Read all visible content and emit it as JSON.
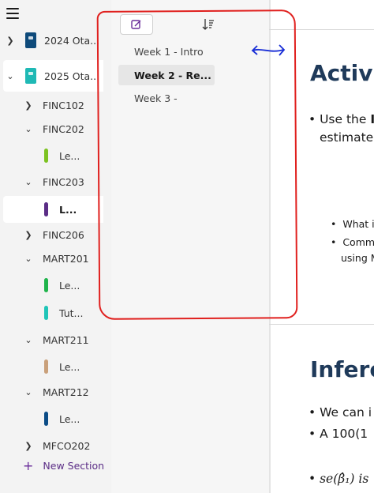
{
  "sidebar": {
    "notebooks": [
      {
        "label": "2024 Ota...",
        "color": "#0e4a7a",
        "expanded": false
      },
      {
        "label": "2025 Ota...",
        "color": "#1fb9b5",
        "expanded": true
      }
    ],
    "sections": [
      {
        "label": "FINC102",
        "expanded": false
      },
      {
        "label": "FINC202",
        "expanded": true,
        "pages": [
          {
            "label": "Le...",
            "color": "#7cc221"
          }
        ]
      },
      {
        "label": "FINC203",
        "expanded": true,
        "pages": [
          {
            "label": "L...",
            "color": "#5b2d86",
            "selected": true
          }
        ]
      },
      {
        "label": "FINC206",
        "expanded": false
      },
      {
        "label": "MART201",
        "expanded": true,
        "pages": [
          {
            "label": "Le...",
            "color": "#1fb44b"
          },
          {
            "label": "Tut...",
            "color": "#1fc5b8"
          }
        ]
      },
      {
        "label": "MART211",
        "expanded": true,
        "pages": [
          {
            "label": "Le...",
            "color": "#c9a07a"
          }
        ]
      },
      {
        "label": "MART212",
        "expanded": true,
        "pages": [
          {
            "label": "Le...",
            "color": "#0b4c86"
          }
        ]
      },
      {
        "label": "MFCO202",
        "expanded": false
      }
    ],
    "new_section_label": "New Section"
  },
  "pagelist": {
    "pages": [
      {
        "label": "Week 1 - Intro",
        "active": false
      },
      {
        "label": "Week 2 - Re...",
        "active": true
      },
      {
        "label": "Week 3 -",
        "active": false
      }
    ]
  },
  "content": {
    "heading1": "Activit",
    "bullet1_line1_a": "Use the ",
    "bullet1_line1_b": "I",
    "bullet1_line2": "estimate",
    "sub_bullet1": "What i",
    "sub_bullet2_line1": "Comm",
    "sub_bullet2_line2": "using M",
    "heading2": "Inferen",
    "bullet2": "We can i",
    "bullet3": "A 100(1",
    "formula": "se(β̂₁) is"
  },
  "colors": {
    "annotation_red": "#e0201e",
    "annotation_blue": "#1a2fd6",
    "accent_purple": "#6a2d9a",
    "heading_blue": "#1f3a5a"
  }
}
